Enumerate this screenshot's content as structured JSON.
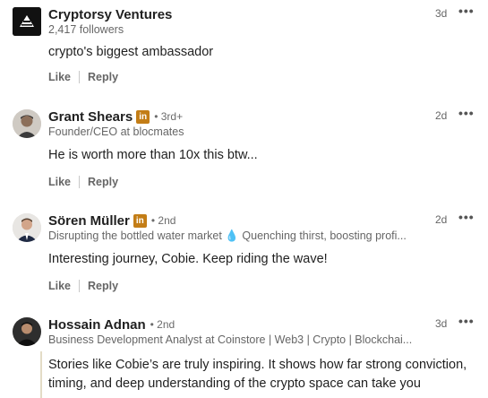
{
  "comments": [
    {
      "name": "Cryptorsy Ventures",
      "subtitle": "2,417 followers",
      "time": "3d",
      "text": "crypto's biggest ambassador",
      "like": "Like",
      "reply": "Reply"
    },
    {
      "name": "Grant Shears",
      "badge": "in",
      "degree": "• 3rd+",
      "subtitle": "Founder/CEO at blocmates",
      "time": "2d",
      "text": "He is worth more than 10x this btw...",
      "like": "Like",
      "reply": "Reply"
    },
    {
      "name": "Sören Müller",
      "badge": "in",
      "degree": "• 2nd",
      "subtitle_part1": "Disrupting the bottled water market",
      "subtitle_part2": "Quenching thirst, boosting profi...",
      "time": "2d",
      "text": "Interesting journey, Cobie. Keep riding the wave!",
      "like": "Like",
      "reply": "Reply"
    },
    {
      "name": "Hossain Adnan",
      "degree": "• 2nd",
      "subtitle": "Business Development Analyst at Coinstore | Web3 | Crypto | Blockchai...",
      "time": "3d",
      "text": "Stories like Cobie’s are truly inspiring. It shows how far strong conviction, timing, and deep understanding of the crypto space can take you"
    }
  ],
  "more_glyph": "•••"
}
